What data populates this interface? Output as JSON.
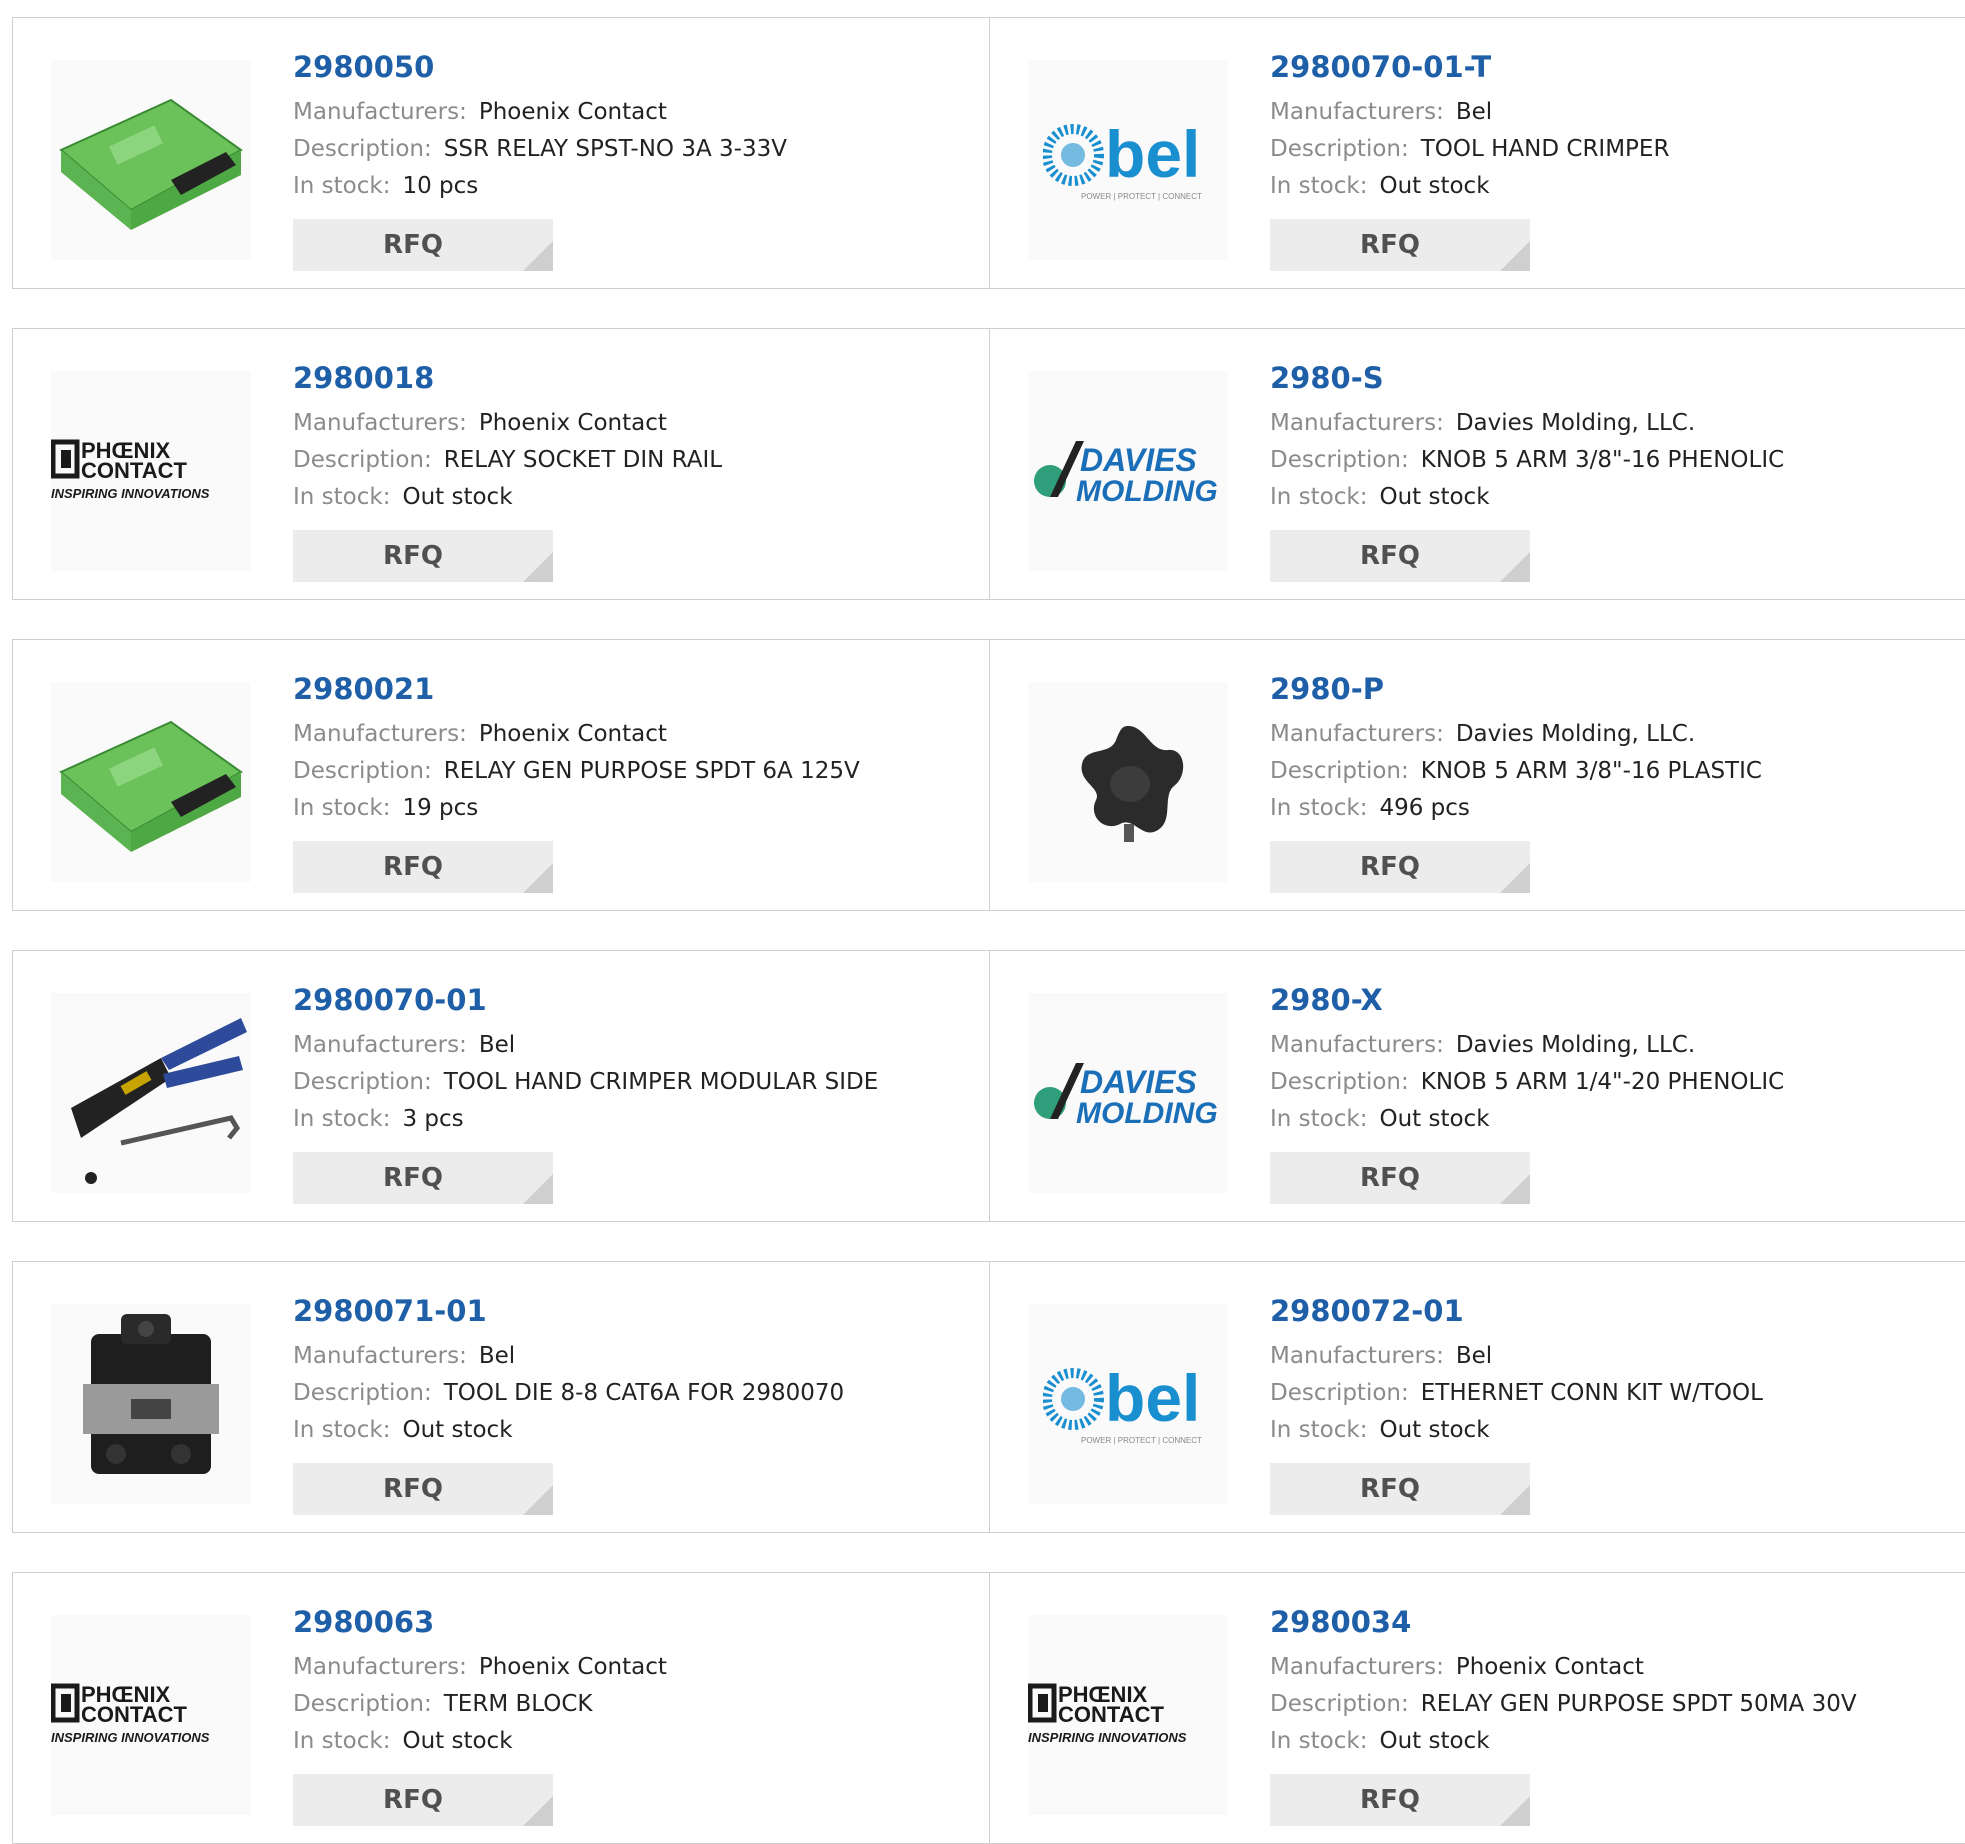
{
  "labels": {
    "manufacturers": "Manufacturers:",
    "description": "Description:",
    "in_stock": "In stock:",
    "rfq": "RFQ"
  },
  "products": [
    {
      "part": "2980050",
      "manufacturer": "Phoenix Contact",
      "description": "SSR RELAY SPST-NO 3A 3-33V",
      "stock": "10 pcs",
      "image": "relay-module-image"
    },
    {
      "part": "2980070-01-T",
      "manufacturer": "Bel",
      "description": "TOOL HAND CRIMPER",
      "stock": "Out stock",
      "image": "bel-logo"
    },
    {
      "part": "2980018",
      "manufacturer": "Phoenix Contact",
      "description": "RELAY SOCKET DIN RAIL",
      "stock": "Out stock",
      "image": "phoenix-contact-logo"
    },
    {
      "part": "2980-S",
      "manufacturer": "Davies Molding, LLC.",
      "description": "KNOB 5 ARM 3/8\"-16 PHENOLIC",
      "stock": "Out stock",
      "image": "davies-molding-logo"
    },
    {
      "part": "2980021",
      "manufacturer": "Phoenix Contact",
      "description": "RELAY GEN PURPOSE SPDT 6A 125V",
      "stock": "19 pcs",
      "image": "relay-module-image"
    },
    {
      "part": "2980-P",
      "manufacturer": "Davies Molding, LLC.",
      "description": "KNOB 5 ARM 3/8\"-16 PLASTIC",
      "stock": "496 pcs",
      "image": "knob-image"
    },
    {
      "part": "2980070-01",
      "manufacturer": "Bel",
      "description": "TOOL HAND CRIMPER MODULAR SIDE",
      "stock": "3 pcs",
      "image": "crimper-tool-image"
    },
    {
      "part": "2980-X",
      "manufacturer": "Davies Molding, LLC.",
      "description": "KNOB 5 ARM 1/4\"-20 PHENOLIC",
      "stock": "Out stock",
      "image": "davies-molding-logo"
    },
    {
      "part": "2980071-01",
      "manufacturer": "Bel",
      "description": "TOOL DIE 8-8 CAT6A FOR 2980070",
      "stock": "Out stock",
      "image": "tool-die-image"
    },
    {
      "part": "2980072-01",
      "manufacturer": "Bel",
      "description": "ETHERNET CONN KIT W/TOOL",
      "stock": "Out stock",
      "image": "bel-logo"
    },
    {
      "part": "2980063",
      "manufacturer": "Phoenix Contact",
      "description": "TERM BLOCK",
      "stock": "Out stock",
      "image": "phoenix-contact-logo"
    },
    {
      "part": "2980034",
      "manufacturer": "Phoenix Contact",
      "description": "RELAY GEN PURPOSE SPDT 50MA 30V",
      "stock": "Out stock",
      "image": "phoenix-contact-logo"
    }
  ],
  "logo_text": {
    "bel": "bel",
    "bel_tagline": "POWER | PROTECT | CONNECT",
    "phoenix_1": "PHŒNIX",
    "phoenix_2": "CONTACT",
    "phoenix_tagline": "INSPIRING INNOVATIONS",
    "davies_1": "DAVIES",
    "davies_2": "MOLDING"
  },
  "colors": {
    "part_link": "#1f5fa8",
    "label": "#8b8b8b",
    "value": "#222222",
    "border": "#cfcfcf",
    "rfq_bg": "#ececec",
    "bel_blue": "#1a8fd0",
    "phoenix_black": "#1a1a1a",
    "davies_blue": "#1b6fb8",
    "davies_green": "#2f9e7a",
    "relay_green": "#6cc25a"
  }
}
